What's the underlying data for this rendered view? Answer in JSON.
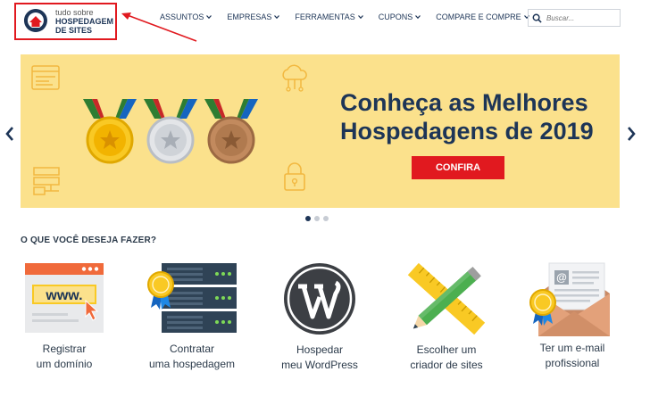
{
  "logo": {
    "line1": "tudo sobre",
    "line2": "HOSPEDAGEM",
    "line3": "DE SITES"
  },
  "nav": [
    {
      "label": "ASSUNTOS"
    },
    {
      "label": "EMPRESAS"
    },
    {
      "label": "FERRAMENTAS"
    },
    {
      "label": "CUPONS"
    },
    {
      "label": "COMPARE E COMPRE"
    }
  ],
  "search": {
    "placeholder": "Buscar..."
  },
  "banner": {
    "title_line1": "Conheça as Melhores",
    "title_line2": "Hospedagens de 2019",
    "cta": "CONFIRA"
  },
  "section": {
    "title": "O QUE VOCÊ DESEJA FAZER?",
    "cards": [
      {
        "line1": "Registrar",
        "line2": "um domínio",
        "icon": "www-browser-icon"
      },
      {
        "line1": "Contratar",
        "line2": "uma hospedagem",
        "icon": "server-icon"
      },
      {
        "line1": "Hospedar",
        "line2": "meu WordPress",
        "icon": "wordpress-icon"
      },
      {
        "line1": "Escolher um",
        "line2": "criador de sites",
        "icon": "ruler-pencil-icon"
      },
      {
        "line1": "Ter um e-mail",
        "line2": "profissional",
        "icon": "email-envelope-icon"
      }
    ]
  },
  "colors": {
    "accent": "#e1191f",
    "navy": "#1d3557",
    "banner_bg": "#fbe18c"
  }
}
